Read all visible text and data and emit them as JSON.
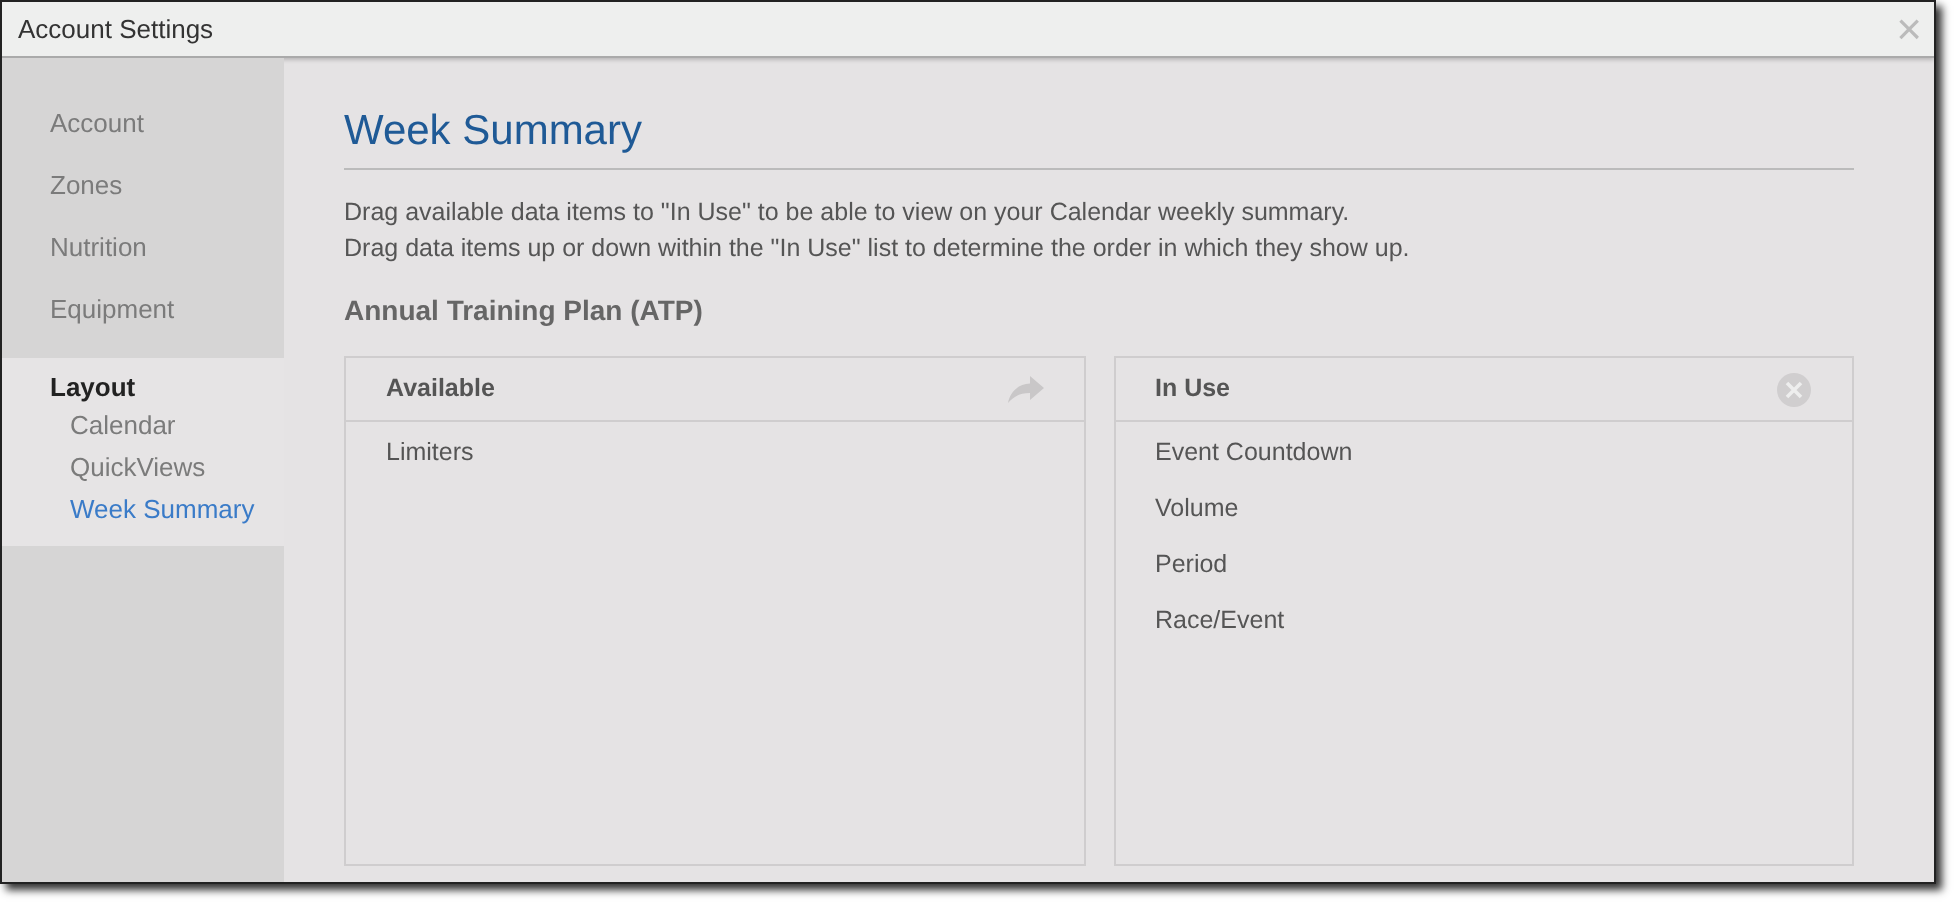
{
  "window": {
    "title": "Account Settings",
    "close": "×"
  },
  "sidebar": {
    "items": [
      {
        "label": "Account"
      },
      {
        "label": "Zones"
      },
      {
        "label": "Nutrition"
      },
      {
        "label": "Equipment"
      },
      {
        "label": "Layout",
        "children": [
          {
            "label": "Calendar",
            "selected": false
          },
          {
            "label": "QuickViews",
            "selected": false
          },
          {
            "label": "Week Summary",
            "selected": true
          }
        ]
      }
    ]
  },
  "content": {
    "title": "Week Summary",
    "description": [
      "Drag available data items to \"In Use\" to be able to view on your Calendar weekly summary.",
      "Drag data items up or down within the \"In Use\" list to determine the order in which they show up."
    ],
    "section": "Annual Training Plan (ATP)",
    "panels": [
      {
        "title": "Available",
        "kind": "add",
        "items": [
          "Limiters"
        ]
      },
      {
        "title": "In Use",
        "kind": "remove",
        "items": [
          "Event Countdown",
          "Volume",
          "Period",
          "Race/Event"
        ]
      }
    ]
  }
}
